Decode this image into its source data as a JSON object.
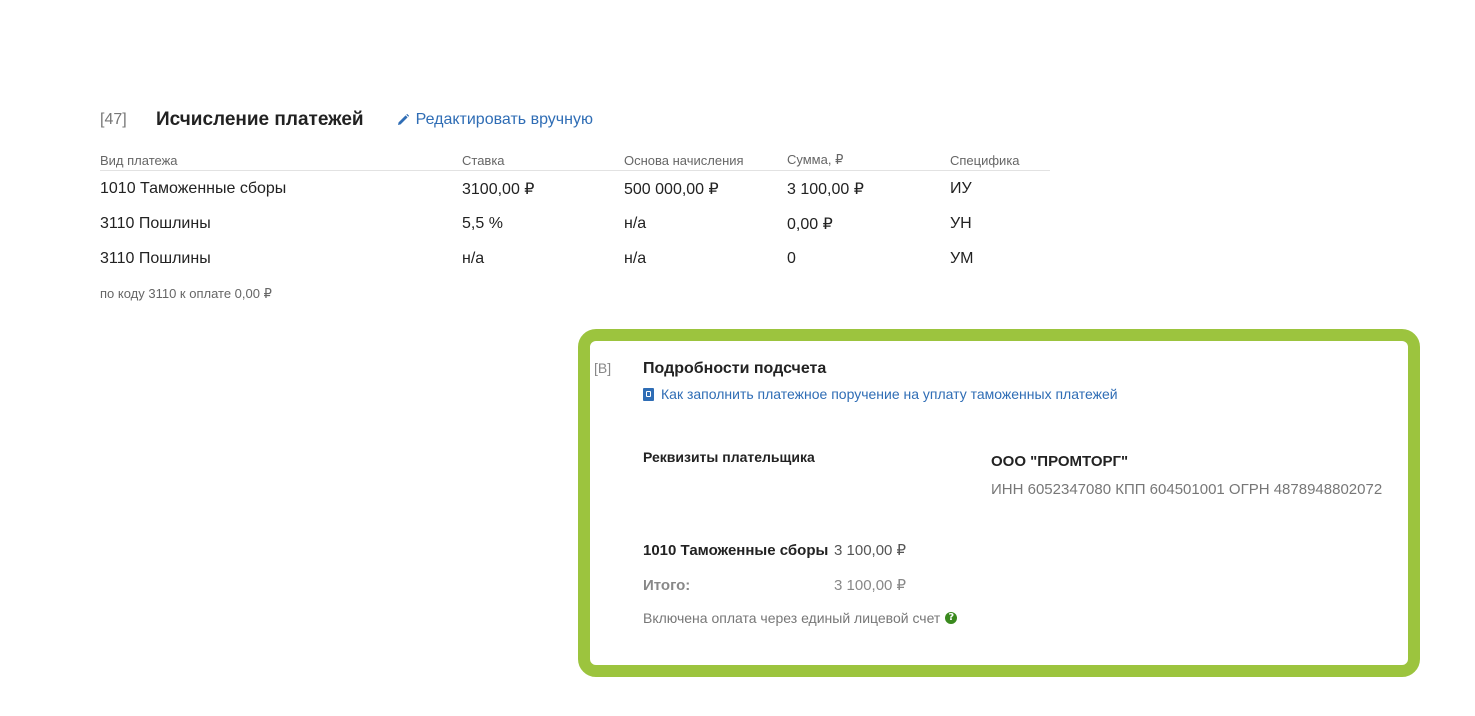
{
  "section": {
    "number": "[47]",
    "title": "Исчисление платежей",
    "edit_label": "Редактировать вручную"
  },
  "table": {
    "headers": [
      "Вид платежа",
      "Ставка",
      "Основа начисления",
      "Сумма, ₽",
      "Специфика"
    ],
    "rows": [
      [
        "1010 Таможенные сборы",
        "3100,00 ₽",
        "500 000,00 ₽",
        "3 100,00 ₽",
        "ИУ"
      ],
      [
        "3110 Пошлины",
        "5,5 %",
        "н/а",
        "0,00 ₽",
        "УН"
      ],
      [
        "3110 Пошлины",
        "н/а",
        "н/а",
        "0",
        "УМ"
      ]
    ],
    "note": "по коду 3110 к оплате 0,00 ₽"
  },
  "details": {
    "number": "[B]",
    "title": "Подробности подсчета",
    "help_link": "Как заполнить платежное поручение на уплату таможенных платежей",
    "payer_label": "Реквизиты плательщика",
    "payer_name": "ООО \"ПРОМТОРГ\"",
    "payer_requisites": "ИНН 6052347080 КПП 604501001 ОГРН 4878948802072",
    "lines": [
      {
        "label": "1010 Таможенные сборы",
        "value": "3 100,00 ₽"
      },
      {
        "label": "Итого:",
        "value": "3 100,00 ₽"
      }
    ],
    "note": "Включена оплата через единый лицевой счет",
    "help_icon_glyph": "?"
  },
  "colors": {
    "accent": "#9cc43e",
    "link": "#2f6db5",
    "help_icon": "#3a8a1e"
  }
}
